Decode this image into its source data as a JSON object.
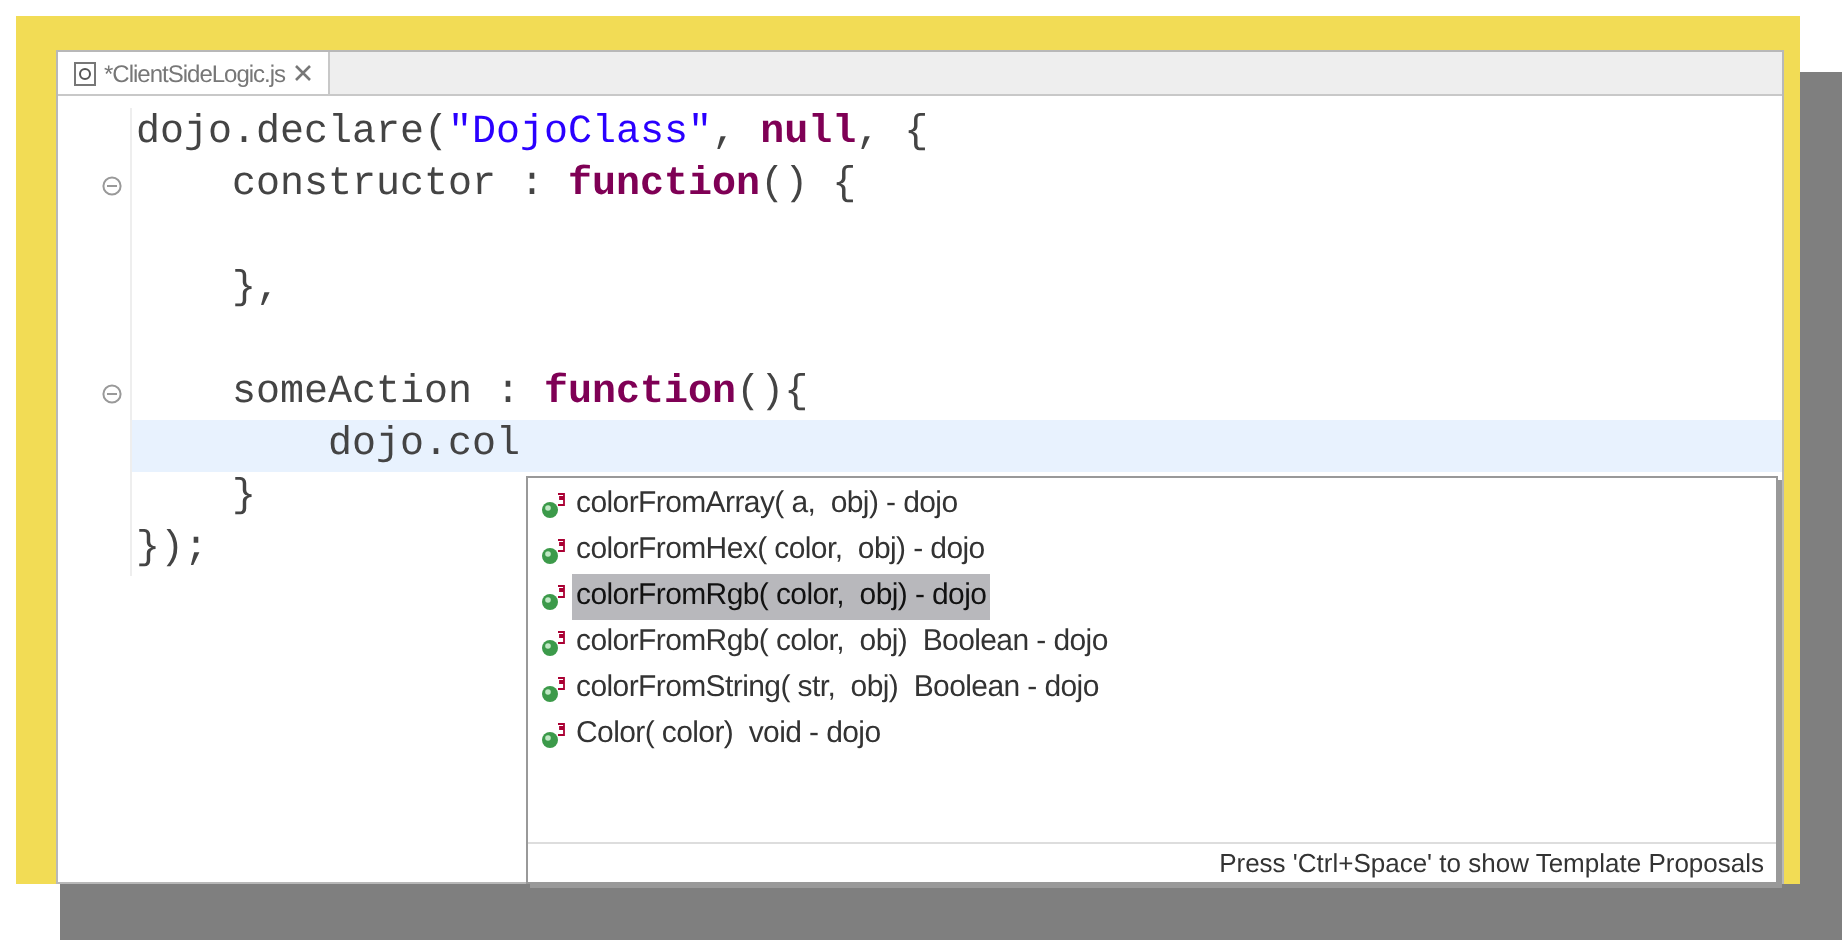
{
  "tab": {
    "title": "*ClientSideLogic.js"
  },
  "code_lines": [
    {
      "kind": "plain",
      "tokens": [
        {
          "kind": "plain",
          "text": "dojo.declare("
        },
        {
          "kind": "string",
          "text": "\"DojoClass\""
        },
        {
          "kind": "plain",
          "text": ", "
        },
        {
          "kind": "keyword",
          "text": "null"
        },
        {
          "kind": "plain",
          "text": ", {"
        }
      ]
    },
    {
      "kind": "fold-start",
      "tokens": [
        {
          "kind": "plain",
          "text": "    constructor : "
        },
        {
          "kind": "keyword",
          "text": "function"
        },
        {
          "kind": "plain",
          "text": "() {"
        }
      ]
    },
    {
      "kind": "plain"
    },
    {
      "kind": "plain",
      "tokens": [
        {
          "kind": "plain",
          "text": "    },"
        }
      ]
    },
    {
      "kind": "plain"
    },
    {
      "kind": "fold-start",
      "tokens": [
        {
          "kind": "plain",
          "text": "    someAction : "
        },
        {
          "kind": "keyword",
          "text": "function"
        },
        {
          "kind": "plain",
          "text": "(){"
        }
      ]
    },
    {
      "kind": "current",
      "tokens": [
        {
          "kind": "plain",
          "text": "        dojo.col"
        }
      ]
    },
    {
      "kind": "plain",
      "tokens": [
        {
          "kind": "plain",
          "text": "    }"
        }
      ]
    },
    {
      "kind": "plain",
      "tokens": [
        {
          "kind": "plain",
          "text": "});"
        }
      ]
    }
  ],
  "proposals": [
    {
      "label": "colorFromArray( a,  obj) - dojo",
      "selected": false
    },
    {
      "label": "colorFromHex( color,  obj) - dojo",
      "selected": false
    },
    {
      "label": "colorFromRgb( color,  obj) - dojo",
      "selected": true
    },
    {
      "label": "colorFromRgb( color,  obj)  Boolean - dojo",
      "selected": false
    },
    {
      "label": "colorFromString( str,  obj)  Boolean - dojo",
      "selected": false
    },
    {
      "label": "Color( color)  void - dojo",
      "selected": false
    }
  ],
  "status_hint": "Press 'Ctrl+Space' to show Template Proposals"
}
